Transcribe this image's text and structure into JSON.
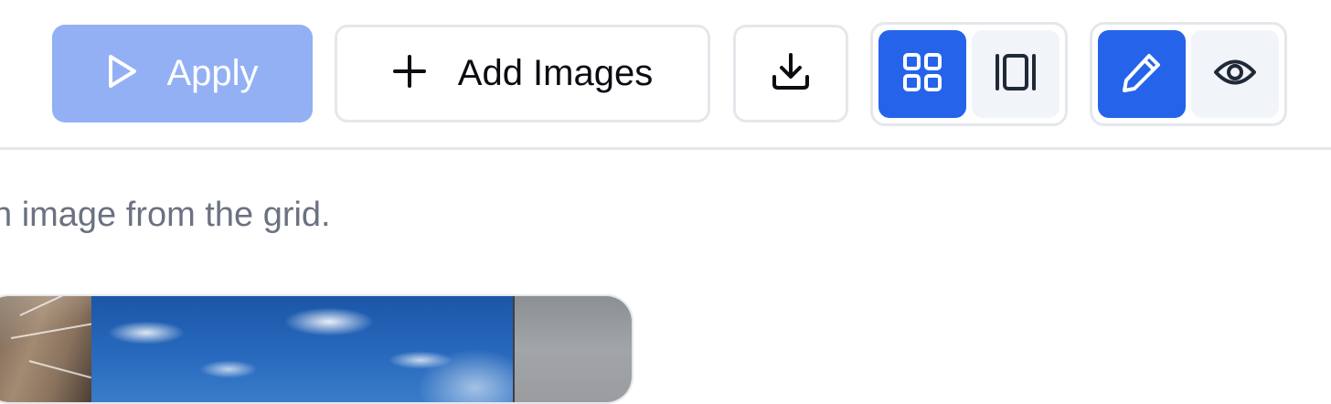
{
  "toolbar": {
    "apply_label": "Apply",
    "add_images_label": "Add Images",
    "download_icon": "download-icon",
    "view_toggle": {
      "grid_icon": "grid-icon",
      "single_icon": "single-view-icon",
      "active": "grid"
    },
    "mode_toggle": {
      "edit_icon": "pencil-icon",
      "preview_icon": "eye-icon",
      "active": "edit"
    }
  },
  "main": {
    "helper_text": "n image from the grid."
  },
  "colors": {
    "accent": "#2563eb",
    "apply_disabled": "#93b0f4",
    "border": "#e5e7eb",
    "muted_text": "#6b7280"
  }
}
